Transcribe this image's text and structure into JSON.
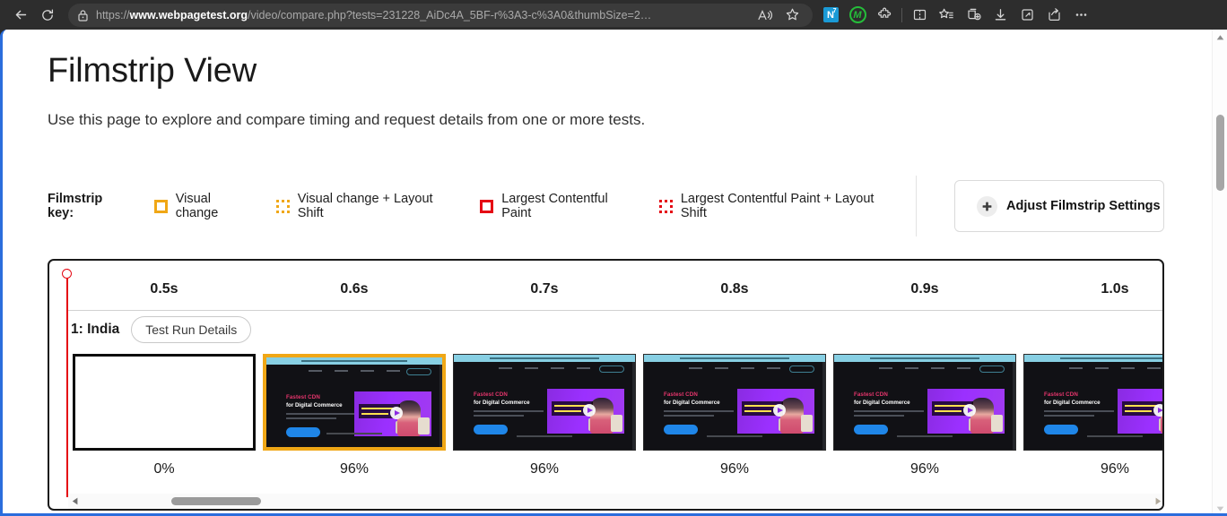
{
  "browser": {
    "back_label": "Back",
    "refresh_label": "Refresh",
    "url_scheme": "https://",
    "url_host": "www.webpagetest.org",
    "url_path": "/video/compare.php?tests=231228_AiDc4A_5BF-r%3A3-c%3A0&thumbSize=2…",
    "read_aloud_label": "Read aloud",
    "favorite_label": "Add this page to favorites",
    "extensions": [
      {
        "name": "ext-n7-icon",
        "label": "N",
        "sup": "7"
      },
      {
        "name": "ext-m-icon",
        "label": "M"
      }
    ],
    "toolbar_icons": [
      "puzzle-icon",
      "split-screen-icon",
      "favorites-icon",
      "collections-icon",
      "downloads-icon",
      "browser-essentials-icon",
      "share-icon",
      "more-options-icon"
    ]
  },
  "page": {
    "title": "Filmstrip View",
    "subtitle": "Use this page to explore and compare timing and request details from one or more tests."
  },
  "legend": {
    "title": "Filmstrip key:",
    "items": [
      {
        "label": "Visual change",
        "style": "solid",
        "color": "#f0a716"
      },
      {
        "label": "Visual change + Layout Shift",
        "style": "dotted",
        "color": "#f0a716"
      },
      {
        "label": "Largest Contentful Paint",
        "style": "solid",
        "color": "#e50914"
      },
      {
        "label": "Largest Contentful Paint + Layout Shift",
        "style": "dotted",
        "color": "#e50914"
      }
    ]
  },
  "adjust_button": {
    "label": "Adjust Filmstrip Settings",
    "icon": "plus-icon"
  },
  "filmstrip": {
    "time_labels": [
      "0.5s",
      "0.6s",
      "0.7s",
      "0.8s",
      "0.9s",
      "1.0s"
    ],
    "run": {
      "name": "1: India",
      "details_label": "Test Run Details"
    },
    "thumbnails": [
      {
        "percent": "0%",
        "border": "black",
        "blank": true
      },
      {
        "percent": "96%",
        "border": "orange",
        "blank": false
      },
      {
        "percent": "96%",
        "border": "thin",
        "blank": false
      },
      {
        "percent": "96%",
        "border": "thin",
        "blank": false
      },
      {
        "percent": "96%",
        "border": "thin",
        "blank": false
      },
      {
        "percent": "96%",
        "border": "thin",
        "blank": false
      }
    ],
    "mini_page": {
      "heading_1": "Fastest CDN",
      "heading_2": "for Digital Commerce"
    }
  }
}
